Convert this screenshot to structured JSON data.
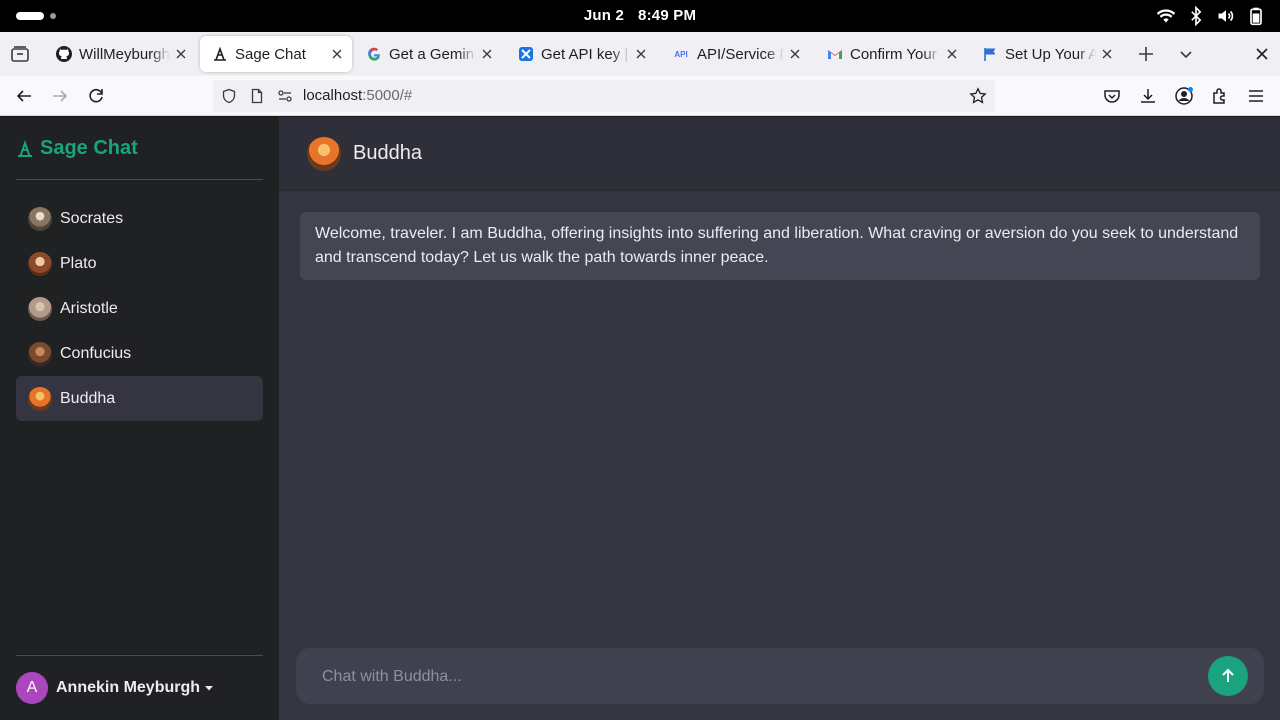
{
  "system": {
    "date": "Jun 2",
    "time": "8:49 PM"
  },
  "browser": {
    "tabs": [
      {
        "label": "WillMeyburgh/",
        "icon": "github-icon"
      },
      {
        "label": "Sage Chat",
        "icon": "sage-logo-icon",
        "active": true
      },
      {
        "label": "Get a Gemini A",
        "icon": "google-icon"
      },
      {
        "label": "Get API key | Go",
        "icon": "butterfly-icon"
      },
      {
        "label": "API/Service Det",
        "icon": "api-icon"
      },
      {
        "label": "Confirm Your F",
        "icon": "gmail-icon"
      },
      {
        "label": "Set Up Your Ac",
        "icon": "flag-icon"
      }
    ],
    "url_host": "localhost",
    "url_rest": ":5000/#"
  },
  "app": {
    "title": "Sage Chat",
    "accent_color": "#19a37e",
    "sages": [
      {
        "name": "Socrates"
      },
      {
        "name": "Plato"
      },
      {
        "name": "Aristotle"
      },
      {
        "name": "Confucius"
      },
      {
        "name": "Buddha",
        "active": true
      }
    ],
    "user": {
      "initial": "A",
      "name": "Annekin Meyburgh"
    }
  },
  "chat": {
    "title": "Buddha",
    "messages": [
      {
        "sender": "Buddha",
        "text": "Welcome, traveler. I am Buddha, offering insights into suffering and liberation. What craving or aversion do you seek to understand and transcend today? Let us walk the path towards inner peace."
      }
    ],
    "input_placeholder": "Chat with Buddha...",
    "input_value": ""
  }
}
